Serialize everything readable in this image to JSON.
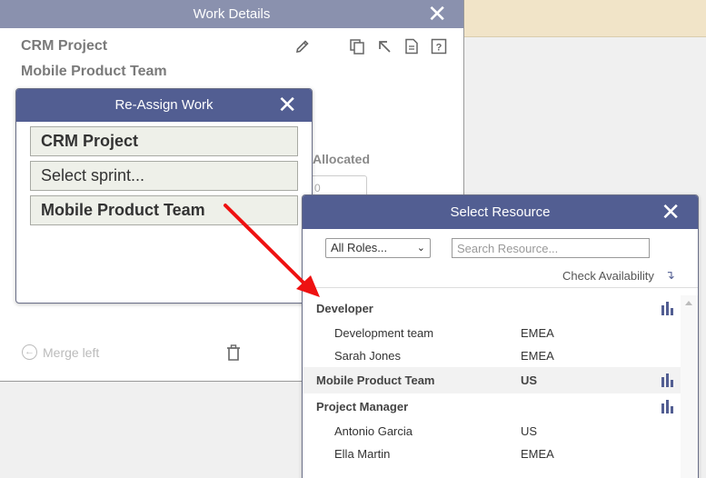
{
  "work_details": {
    "title": "Work Details",
    "project": "CRM Project",
    "team": "Mobile Product Team",
    "allocated_label": "Allocated",
    "allocated_value": "0",
    "merge_left": "Merge left"
  },
  "reassign": {
    "title": "Re-Assign Work",
    "project": "CRM Project",
    "sprint_placeholder": "Select sprint...",
    "team": "Mobile Product Team"
  },
  "select_resource": {
    "title": "Select Resource",
    "roles_selected": "All Roles...",
    "search_placeholder": "Search Resource...",
    "check_availability": "Check Availability",
    "list": [
      {
        "type": "group",
        "name": "Developer",
        "region": ""
      },
      {
        "type": "item",
        "name": "Development team",
        "region": "EMEA"
      },
      {
        "type": "item",
        "name": "Sarah Jones",
        "region": "EMEA"
      },
      {
        "type": "group",
        "name": "Mobile Product Team",
        "region": "US"
      },
      {
        "type": "group",
        "name": "Project Manager",
        "region": ""
      },
      {
        "type": "item",
        "name": "Antonio Garcia",
        "region": "US"
      },
      {
        "type": "item",
        "name": "Ella Martin",
        "region": "EMEA"
      }
    ]
  },
  "colors": {
    "dialog_header": "#525e92",
    "panel_header": "#8a91ae",
    "arrow": "#ee1111"
  }
}
